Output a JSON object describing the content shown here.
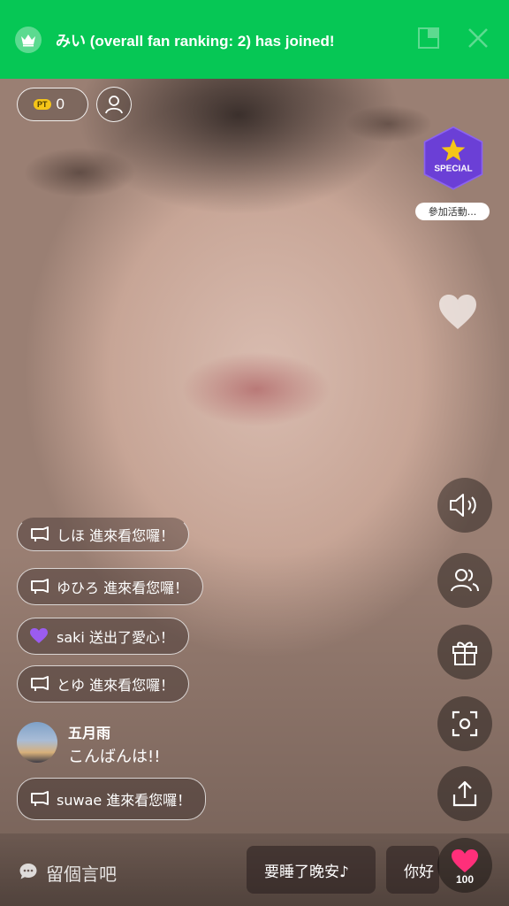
{
  "banner": {
    "text": "みい (overall fan ranking: 2) has joined!",
    "icon": "crown-icon",
    "color": "#06c755"
  },
  "points": {
    "badge": "PT",
    "value": "0"
  },
  "special": {
    "badge_text": "SPECIAL",
    "label": "參加活動..."
  },
  "chat": {
    "items": [
      {
        "type": "join",
        "text": "しほ 進來看您囉！",
        "icon": "megaphone-icon"
      },
      {
        "type": "join",
        "text": "ゆひろ 進來看您囉！",
        "icon": "megaphone-icon"
      },
      {
        "type": "heart",
        "text": "saki 送出了愛心！",
        "icon": "heart-icon"
      },
      {
        "type": "join",
        "text": "とゆ 進來看您囉！",
        "icon": "megaphone-icon"
      },
      {
        "type": "comment",
        "name": "五月雨",
        "text": "こんばんは!!"
      },
      {
        "type": "join",
        "text": "suwae 進來看您囉！",
        "icon": "megaphone-icon"
      }
    ]
  },
  "bottom": {
    "comment_placeholder": "留個言吧",
    "quick_replies": [
      "要睡了晚安♪",
      "你好"
    ],
    "like_count": "100"
  },
  "rail": [
    "speaker-icon",
    "viewers-icon",
    "gift-icon",
    "screenshot-icon",
    "share-icon"
  ],
  "colors": {
    "accent_green": "#06c755",
    "heart_pink": "#ff2f7a",
    "special_purple": "#6b3fd6",
    "special_star": "#f5c518"
  }
}
